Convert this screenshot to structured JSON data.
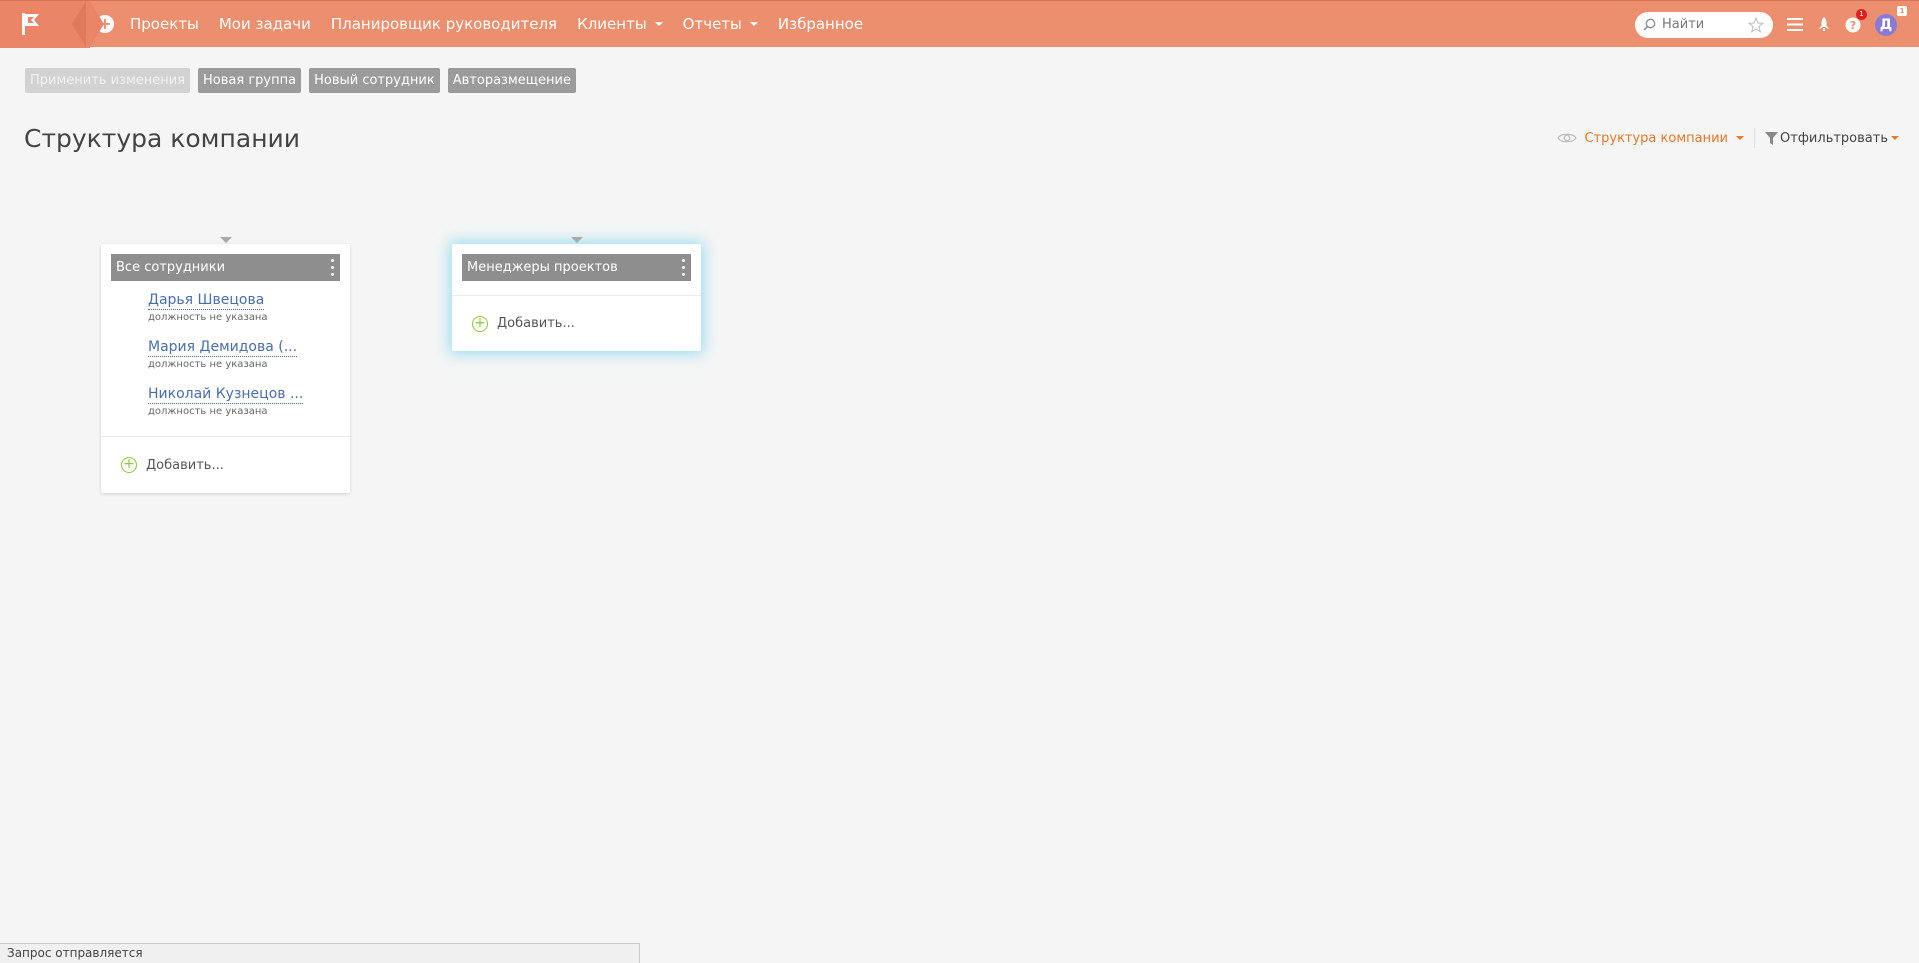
{
  "topbar": {
    "nav": [
      {
        "label": "Проекты",
        "dropdown": false
      },
      {
        "label": "Мои задачи",
        "dropdown": false
      },
      {
        "label": "Планировщик руководителя",
        "dropdown": false
      },
      {
        "label": "Клиенты",
        "dropdown": true
      },
      {
        "label": "Отчеты",
        "dropdown": true
      },
      {
        "label": "Избранное",
        "dropdown": false
      }
    ],
    "search_placeholder": "Найти",
    "help_badge": "1",
    "avatar_letter": "Д",
    "avatar_badge": "1",
    "icons": [
      "flag-logo-icon",
      "plus-icon",
      "search-icon",
      "star-icon",
      "menu-icon",
      "rocket-icon",
      "help-icon"
    ]
  },
  "toolbar": {
    "apply_label": "Применить изменения",
    "new_group_label": "Новая группа",
    "new_employee_label": "Новый сотрудник",
    "autoplace_label": "Авторазмещение"
  },
  "page": {
    "title": "Структура компании",
    "view_select_label": "Структура компании",
    "filter_label": "Отфильтровать"
  },
  "cards": [
    {
      "title": "Все сотрудники",
      "members": [
        {
          "name": "Дарья Швецова",
          "position": "должность не указана"
        },
        {
          "name": "Мария Демидова (...",
          "position": "должность не указана"
        },
        {
          "name": "Николай Кузнецов ...",
          "position": "должность не указана"
        }
      ],
      "add_label": "Добавить..."
    },
    {
      "title": "Менеджеры проектов",
      "members": [],
      "add_label": "Добавить..."
    }
  ],
  "statusbar": {
    "text": "Запрос отправляется"
  },
  "colors": {
    "topbar": "#ec8f6f",
    "accent_orange": "#e8782a",
    "link_blue": "#4a6ea8",
    "add_green": "#8dc63f",
    "header_gray": "#8e8e8e"
  }
}
